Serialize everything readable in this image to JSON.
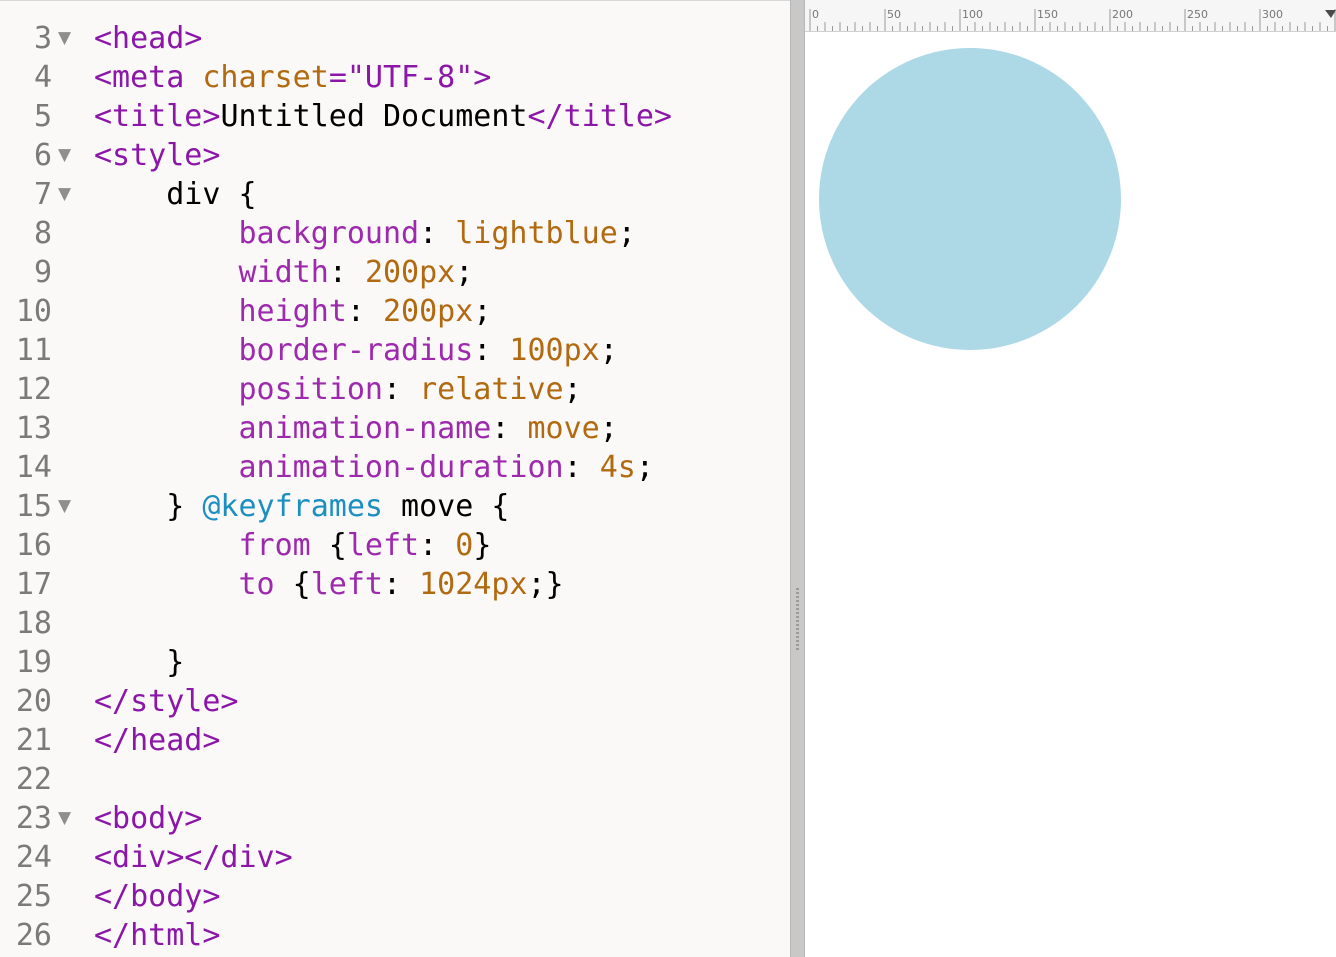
{
  "editor": {
    "lines": [
      {
        "number": "3",
        "fold": "▼",
        "tokens": [
          {
            "text": "<head>",
            "type": "tag"
          }
        ]
      },
      {
        "number": "4",
        "fold": "",
        "tokens": [
          {
            "text": "<meta ",
            "type": "tag"
          },
          {
            "text": "charset",
            "type": "attr"
          },
          {
            "text": "=\"UTF-8\">",
            "type": "value"
          }
        ]
      },
      {
        "number": "5",
        "fold": "",
        "tokens": [
          {
            "text": "<title>",
            "type": "tag"
          },
          {
            "text": "Untitled Document",
            "type": "text"
          },
          {
            "text": "</title>",
            "type": "tag"
          }
        ]
      },
      {
        "number": "6",
        "fold": "▼",
        "tokens": [
          {
            "text": "<style>",
            "type": "tag"
          }
        ]
      },
      {
        "number": "7",
        "fold": "▼",
        "tokens": [
          {
            "text": "    div {",
            "type": "text"
          }
        ]
      },
      {
        "number": "8",
        "fold": "",
        "tokens": [
          {
            "text": "        background",
            "type": "prop"
          },
          {
            "text": ": ",
            "type": "text"
          },
          {
            "text": "lightblue",
            "type": "attr"
          },
          {
            "text": ";",
            "type": "text"
          }
        ]
      },
      {
        "number": "9",
        "fold": "",
        "tokens": [
          {
            "text": "        width",
            "type": "prop"
          },
          {
            "text": ": ",
            "type": "text"
          },
          {
            "text": "200px",
            "type": "num"
          },
          {
            "text": ";",
            "type": "text"
          }
        ]
      },
      {
        "number": "10",
        "fold": "",
        "tokens": [
          {
            "text": "        height",
            "type": "prop"
          },
          {
            "text": ": ",
            "type": "text"
          },
          {
            "text": "200px",
            "type": "num"
          },
          {
            "text": ";",
            "type": "text"
          }
        ]
      },
      {
        "number": "11",
        "fold": "",
        "tokens": [
          {
            "text": "        border-radius",
            "type": "prop"
          },
          {
            "text": ": ",
            "type": "text"
          },
          {
            "text": "100px",
            "type": "num"
          },
          {
            "text": ";",
            "type": "text"
          }
        ]
      },
      {
        "number": "12",
        "fold": "",
        "tokens": [
          {
            "text": "        position",
            "type": "prop"
          },
          {
            "text": ": ",
            "type": "text"
          },
          {
            "text": "relative",
            "type": "attr"
          },
          {
            "text": ";",
            "type": "text"
          }
        ]
      },
      {
        "number": "13",
        "fold": "",
        "tokens": [
          {
            "text": "        animation-name",
            "type": "prop"
          },
          {
            "text": ": ",
            "type": "text"
          },
          {
            "text": "move",
            "type": "attr"
          },
          {
            "text": ";",
            "type": "text"
          }
        ]
      },
      {
        "number": "14",
        "fold": "",
        "tokens": [
          {
            "text": "        animation-duration",
            "type": "prop"
          },
          {
            "text": ": ",
            "type": "text"
          },
          {
            "text": "4s",
            "type": "num"
          },
          {
            "text": ";",
            "type": "text"
          }
        ]
      },
      {
        "number": "15",
        "fold": "▼",
        "tokens": [
          {
            "text": "    } ",
            "type": "text"
          },
          {
            "text": "@keyframes",
            "type": "kw"
          },
          {
            "text": " move {",
            "type": "text"
          }
        ]
      },
      {
        "number": "16",
        "fold": "",
        "tokens": [
          {
            "text": "        from",
            "type": "prop"
          },
          {
            "text": " {",
            "type": "text"
          },
          {
            "text": "left",
            "type": "prop"
          },
          {
            "text": ": ",
            "type": "text"
          },
          {
            "text": "0",
            "type": "num"
          },
          {
            "text": "}",
            "type": "text"
          }
        ]
      },
      {
        "number": "17",
        "fold": "",
        "tokens": [
          {
            "text": "        to",
            "type": "prop"
          },
          {
            "text": " {",
            "type": "text"
          },
          {
            "text": "left",
            "type": "prop"
          },
          {
            "text": ": ",
            "type": "text"
          },
          {
            "text": "1024px",
            "type": "num"
          },
          {
            "text": ";}",
            "type": "text"
          }
        ]
      },
      {
        "number": "18",
        "fold": "",
        "tokens": []
      },
      {
        "number": "19",
        "fold": "",
        "tokens": [
          {
            "text": "    }",
            "type": "text"
          }
        ]
      },
      {
        "number": "20",
        "fold": "",
        "tokens": [
          {
            "text": "</style>",
            "type": "tag"
          }
        ]
      },
      {
        "number": "21",
        "fold": "",
        "tokens": [
          {
            "text": "</head>",
            "type": "tag"
          }
        ]
      },
      {
        "number": "22",
        "fold": "",
        "tokens": []
      },
      {
        "number": "23",
        "fold": "▼",
        "tokens": [
          {
            "text": "<body>",
            "type": "tag"
          }
        ]
      },
      {
        "number": "24",
        "fold": "",
        "tokens": [
          {
            "text": "<div></div>",
            "type": "tag"
          }
        ]
      },
      {
        "number": "25",
        "fold": "",
        "tokens": [
          {
            "text": "</body>",
            "type": "tag"
          }
        ]
      },
      {
        "number": "26",
        "fold": "",
        "tokens": [
          {
            "text": "</html>",
            "type": "tag"
          }
        ]
      }
    ]
  },
  "preview": {
    "ruler": {
      "labels": [
        "0",
        "50",
        "100",
        "150",
        "200",
        "250",
        "300"
      ]
    },
    "ball": {
      "color": "lightblue"
    }
  },
  "colors": {
    "editor_background": "#faf9f7",
    "preview_background": "#ffffff",
    "tag": "#8b16a8",
    "attribute_value": "#b26a11",
    "property": "#9d29ad",
    "keyword": "#1c8fc2"
  }
}
